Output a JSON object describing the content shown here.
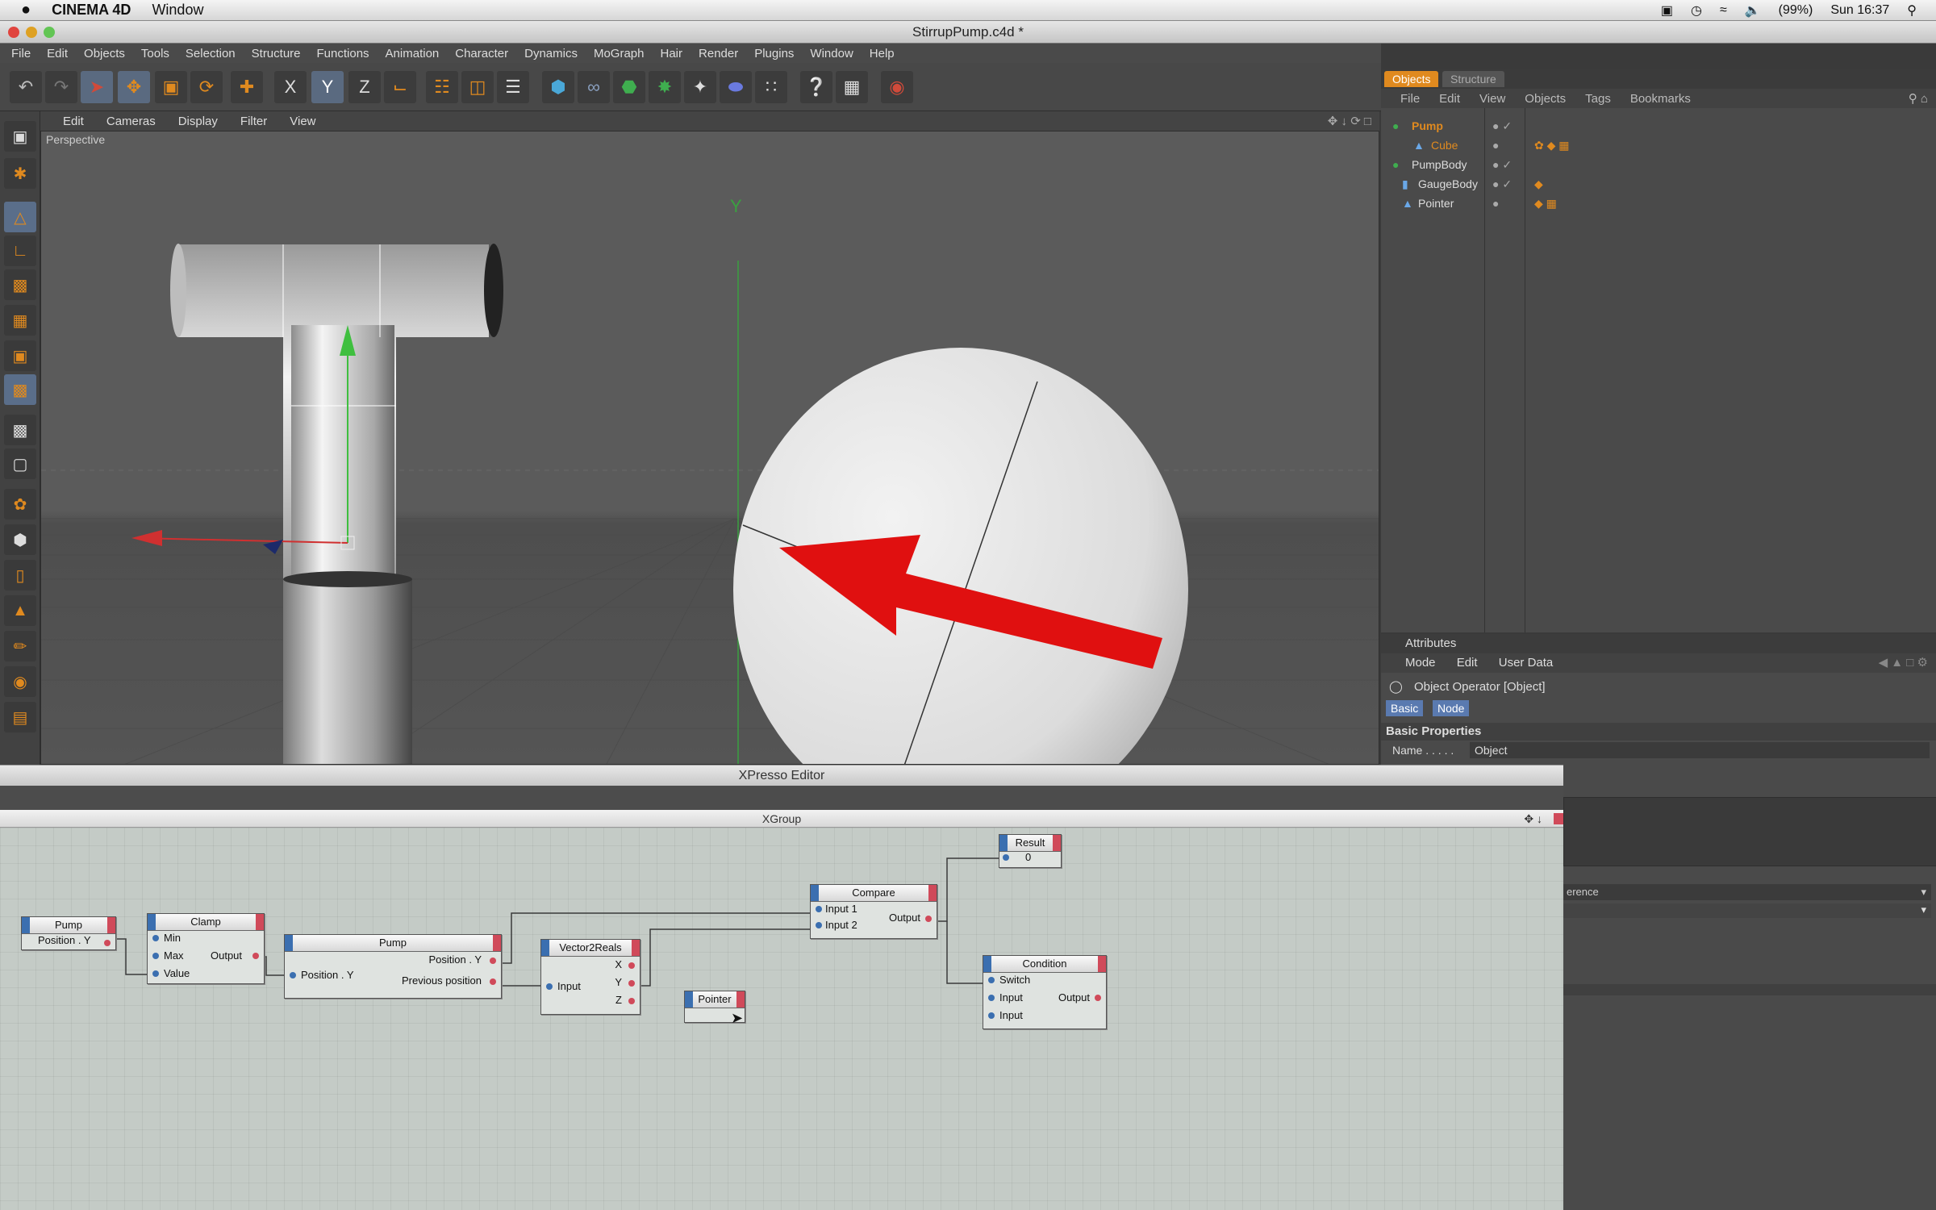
{
  "macbar": {
    "apple": "",
    "app": "CINEMA 4D",
    "window": "Window",
    "battery": "(99%)",
    "clock": "Sun 16:37"
  },
  "window": {
    "title": "StirrupPump.c4d *"
  },
  "menu": [
    "File",
    "Edit",
    "Objects",
    "Tools",
    "Selection",
    "Structure",
    "Functions",
    "Animation",
    "Character",
    "Dynamics",
    "MoGraph",
    "Hair",
    "Render",
    "Plugins",
    "Window",
    "Help"
  ],
  "toolbar": {
    "x": "X",
    "y": "Y",
    "z": "Z"
  },
  "viewport": {
    "menu": [
      "Edit",
      "Cameras",
      "Display",
      "Filter",
      "View"
    ],
    "label": "Perspective"
  },
  "objects": {
    "tabs": [
      "Objects",
      "Structure"
    ],
    "menu": [
      "File",
      "Edit",
      "View",
      "Objects",
      "Tags",
      "Bookmarks"
    ],
    "items": [
      "Pump",
      "Cube",
      "PumpBody",
      "GaugeBody",
      "Pointer"
    ]
  },
  "attributes": {
    "title": "Attributes",
    "menu": [
      "Mode",
      "Edit",
      "User Data"
    ],
    "object": "Object Operator [Object]",
    "tabs": [
      "Basic",
      "Node"
    ],
    "section": "Basic Properties",
    "name_label": "Name . . . . .",
    "name_value": "Object",
    "partial": "erence"
  },
  "xpresso": {
    "title": "XPresso Editor",
    "group": "XGroup",
    "nodes": {
      "pump_small": {
        "title": "Pump",
        "out": "Position . Y"
      },
      "clamp": {
        "title": "Clamp",
        "ports": [
          "Min",
          "Max",
          "Value"
        ],
        "out": "Output"
      },
      "pump": {
        "title": "Pump",
        "in": "Position . Y",
        "outs": [
          "Position . Y",
          "Previous position"
        ]
      },
      "v2r": {
        "title": "Vector2Reals",
        "in": "Input",
        "outs": [
          "X",
          "Y",
          "Z"
        ]
      },
      "pointer": {
        "title": "Pointer"
      },
      "compare": {
        "title": "Compare",
        "ins": [
          "Input 1",
          "Input 2"
        ],
        "out": "Output"
      },
      "result": {
        "title": "Result",
        "value": "0"
      },
      "condition": {
        "title": "Condition",
        "ins": [
          "Switch",
          "Input",
          "Input"
        ],
        "out": "Output"
      }
    }
  }
}
